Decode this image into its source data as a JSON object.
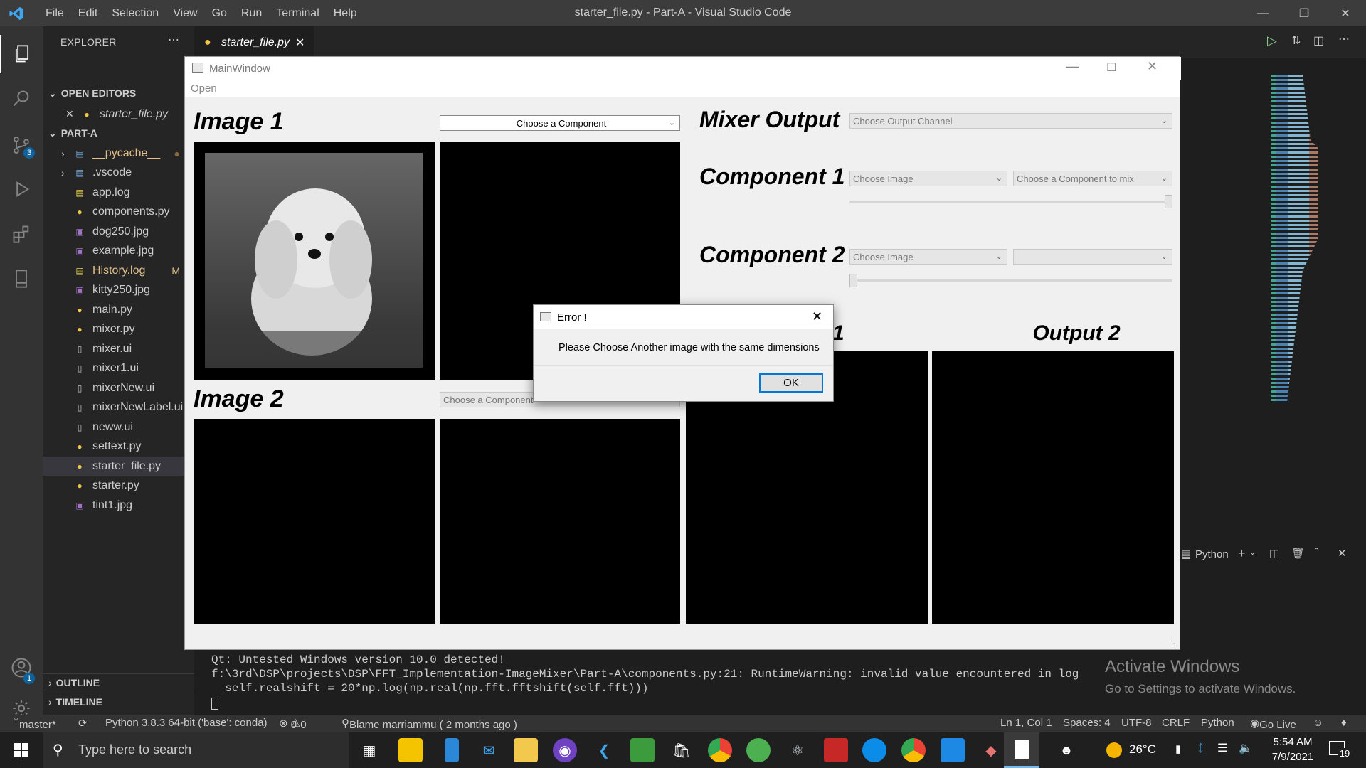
{
  "window": {
    "title": "starter_file.py - Part-A - Visual Studio Code",
    "menu": [
      "File",
      "Edit",
      "Selection",
      "View",
      "Go",
      "Run",
      "Terminal",
      "Help"
    ]
  },
  "sidebar": {
    "title": "EXPLORER",
    "open_editors_label": "OPEN EDITORS",
    "open_editor_file": "starter_file.py",
    "project_label": "PART-A",
    "items": [
      {
        "name": "__pycache__",
        "type": "folder",
        "badge": "●"
      },
      {
        "name": ".vscode",
        "type": "folder",
        "badge": ""
      },
      {
        "name": "app.log",
        "type": "log",
        "badge": ""
      },
      {
        "name": "components.py",
        "type": "py",
        "badge": ""
      },
      {
        "name": "dog250.jpg",
        "type": "img",
        "badge": ""
      },
      {
        "name": "example.jpg",
        "type": "img",
        "badge": ""
      },
      {
        "name": "History.log",
        "type": "log",
        "badge": "M"
      },
      {
        "name": "kitty250.jpg",
        "type": "img",
        "badge": ""
      },
      {
        "name": "main.py",
        "type": "py",
        "badge": ""
      },
      {
        "name": "mixer.py",
        "type": "py",
        "badge": ""
      },
      {
        "name": "mixer.ui",
        "type": "ui",
        "badge": ""
      },
      {
        "name": "mixer1.ui",
        "type": "ui",
        "badge": ""
      },
      {
        "name": "mixerNew.ui",
        "type": "ui",
        "badge": ""
      },
      {
        "name": "mixerNewLabel.ui",
        "type": "ui",
        "badge": ""
      },
      {
        "name": "neww.ui",
        "type": "ui",
        "badge": ""
      },
      {
        "name": "settext.py",
        "type": "py",
        "badge": ""
      },
      {
        "name": "starter_file.py",
        "type": "py",
        "badge": ""
      },
      {
        "name": "starter.py",
        "type": "py",
        "badge": ""
      },
      {
        "name": "tint1.jpg",
        "type": "img",
        "badge": ""
      }
    ],
    "outline_label": "OUTLINE",
    "timeline_label": "TIMELINE"
  },
  "editor": {
    "active_tab": "starter_file.py"
  },
  "terminal": {
    "lines": [
      "Qt: Untested Windows version 10.0 detected!",
      "f:\\3rd\\DSP\\projects\\DSP\\FFT_Implementation-ImageMixer\\Part-A\\components.py:21: RuntimeWarning: invalid value encountered in log",
      "  self.realshift = 20*np.log(np.real(np.fft.fftshift(self.fft)))"
    ],
    "panel_shell": "Python"
  },
  "activate_windows": {
    "title": "Activate Windows",
    "subtitle": "Go to Settings to activate Windows."
  },
  "status": {
    "branch": "master*",
    "interpreter": "Python 3.8.3 64-bit ('base': conda)",
    "errors": "0",
    "warnings": "0",
    "blame": "Blame marriammu ( 2 months ago )",
    "position": "Ln 1, Col 1",
    "spaces": "Spaces: 4",
    "encoding": "UTF-8",
    "eol": "CRLF",
    "language": "Python",
    "golive": "Go Live"
  },
  "mixer": {
    "title": "MainWindow",
    "menu_open": "Open",
    "image1_label": "Image 1",
    "image2_label": "Image 2",
    "image1_component": "Choose a Component",
    "image2_component": "Choose a Component",
    "mixer_output_label": "Mixer Output",
    "output_channel": "Choose Output Channel",
    "component1_label": "Component 1",
    "component2_label": "Component 2",
    "comp1_image": "Choose Image",
    "comp1_type": "Choose a Component to mix",
    "comp2_image": "Choose Image",
    "comp2_type": "",
    "slider1_value": 1.0,
    "slider2_value": 0.0,
    "output1_label": "1",
    "output2_label": "Output 2"
  },
  "dialog": {
    "title": "Error !",
    "message": "Please Choose Another image with the same dimensions",
    "ok": "OK"
  },
  "taskbar": {
    "search_placeholder": "Type here to search",
    "temperature": "26°C",
    "time": "5:54 AM",
    "date": "7/9/2021",
    "notifications": "19"
  }
}
